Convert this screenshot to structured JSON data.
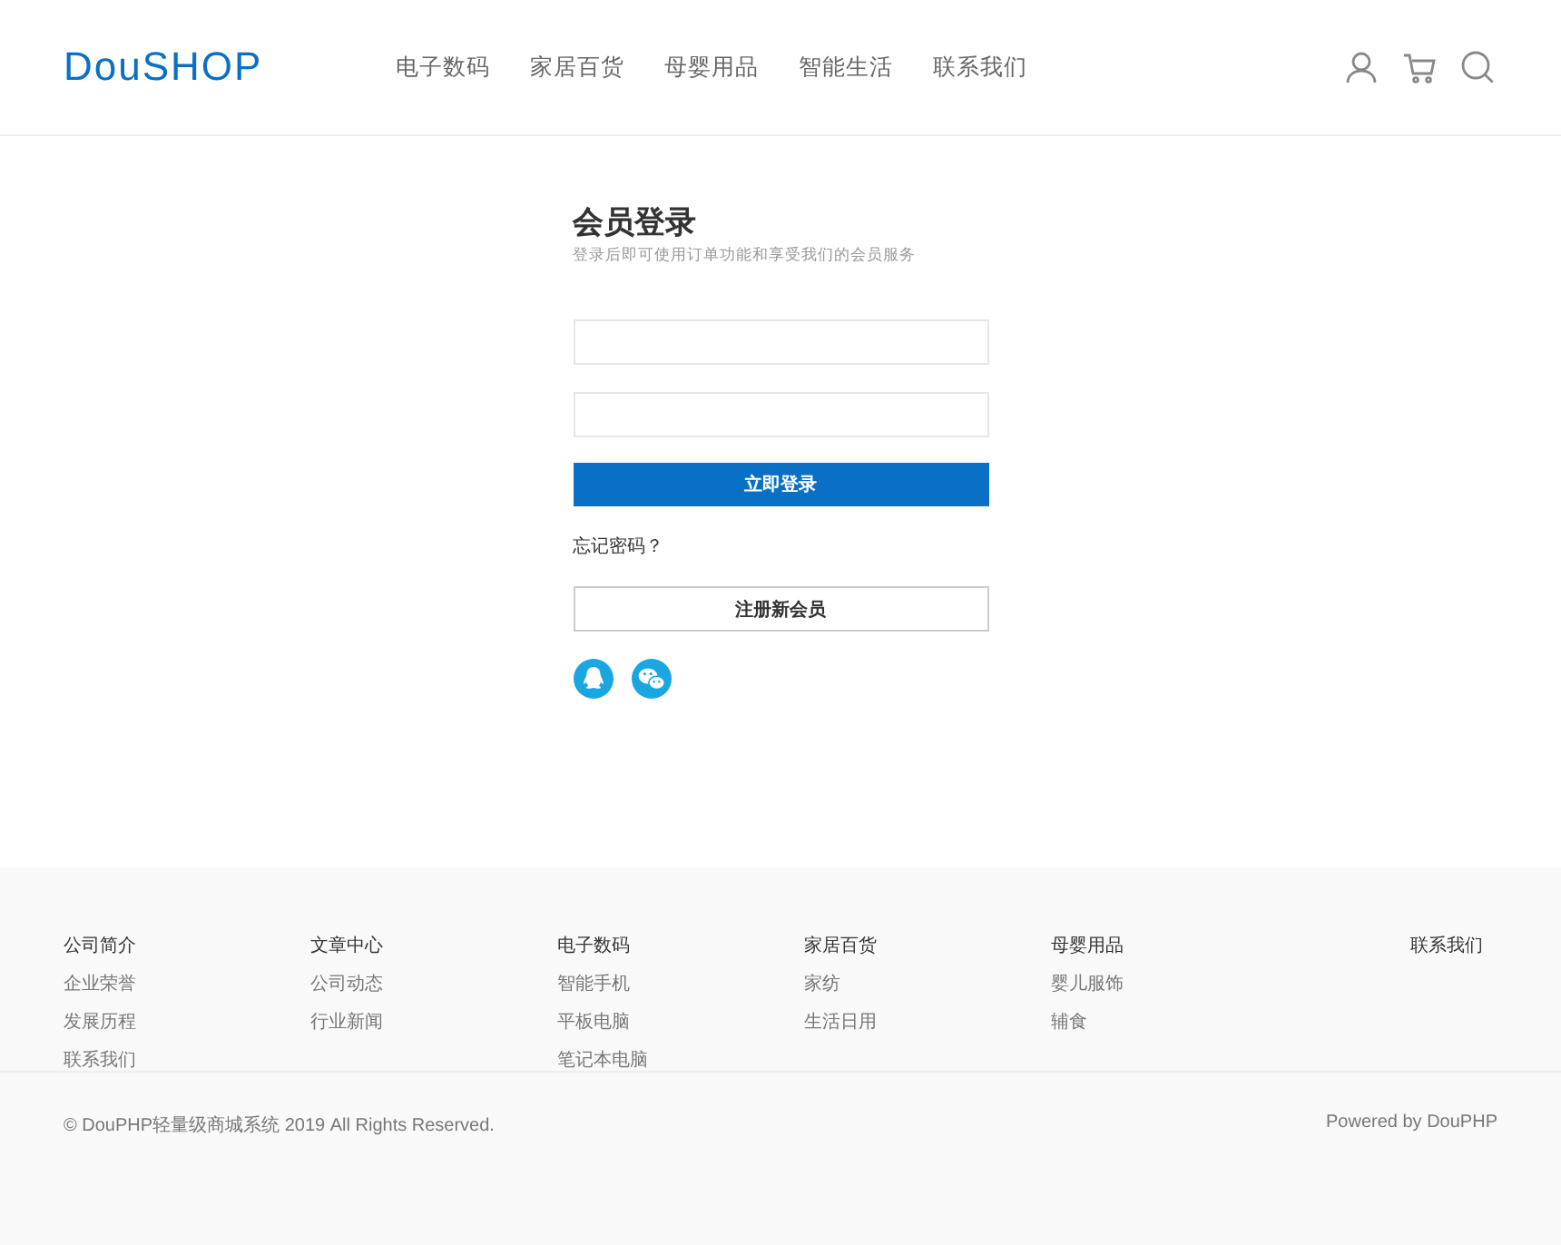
{
  "logo": "DouSHOP",
  "nav": [
    "电子数码",
    "家居百货",
    "母婴用品",
    "智能生活",
    "联系我们"
  ],
  "login": {
    "title": "会员登录",
    "subtitle": "登录后即可使用订单功能和享受我们的会员服务",
    "submit": "立即登录",
    "forgot": "忘记密码？",
    "register": "注册新会员"
  },
  "footer_columns": [
    {
      "title": "公司简介",
      "links": [
        "企业荣誉",
        "发展历程",
        "联系我们"
      ]
    },
    {
      "title": "文章中心",
      "links": [
        "公司动态",
        "行业新闻"
      ]
    },
    {
      "title": "电子数码",
      "links": [
        "智能手机",
        "平板电脑",
        "笔记本电脑"
      ]
    },
    {
      "title": "家居百货",
      "links": [
        "家纺",
        "生活日用"
      ]
    },
    {
      "title": "母婴用品",
      "links": [
        "婴儿服饰",
        "辅食"
      ]
    }
  ],
  "footer_contact": "联系我们",
  "copyright": "© DouPHP轻量级商城系统 2019 All Rights Reserved.",
  "powered": "Powered by DouPHP"
}
